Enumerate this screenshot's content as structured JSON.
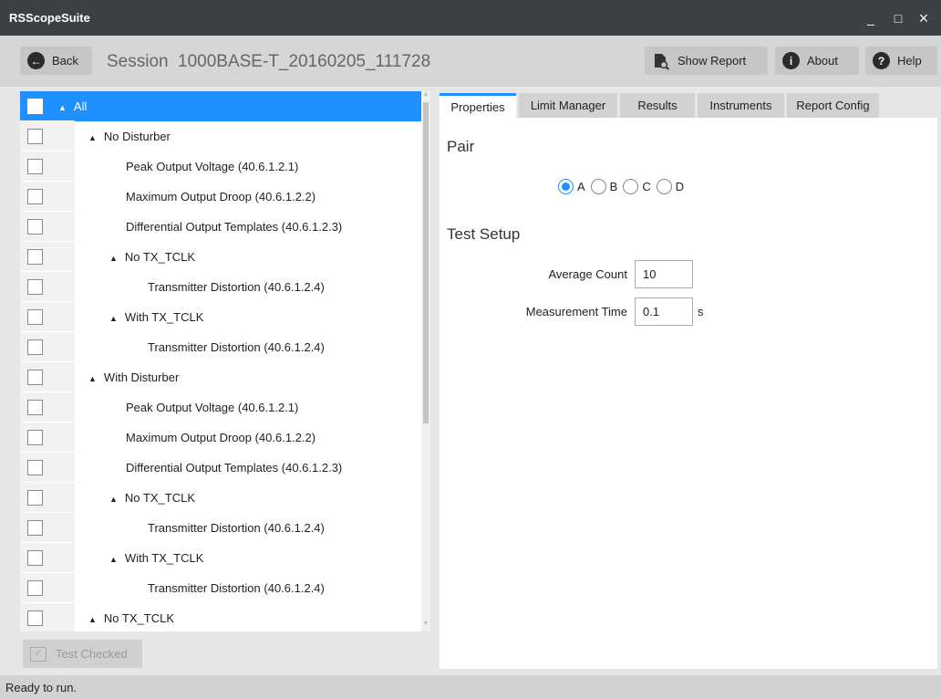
{
  "window": {
    "title": "RSScopeSuite",
    "minimize": "_",
    "maximize": "□",
    "close": "×"
  },
  "toolbar": {
    "back_label": "Back",
    "session_label": "Session",
    "session_name": "1000BASE-T_20160205_111728",
    "show_report_label": "Show Report",
    "about_label": "About",
    "help_label": "Help"
  },
  "tree": {
    "rows": [
      {
        "label": "All",
        "indent": 0,
        "expander": true,
        "selected": true
      },
      {
        "label": "No Disturber",
        "indent": 1,
        "expander": true
      },
      {
        "label": "Peak Output Voltage (40.6.1.2.1)",
        "indent": 2,
        "expander": false
      },
      {
        "label": "Maximum Output Droop (40.6.1.2.2)",
        "indent": 2,
        "expander": false
      },
      {
        "label": "Differential Output Templates (40.6.1.2.3)",
        "indent": 2,
        "expander": false
      },
      {
        "label": "No TX_TCLK",
        "indent": 2,
        "expander": true
      },
      {
        "label": "Transmitter Distortion (40.6.1.2.4)",
        "indent": 3,
        "expander": false
      },
      {
        "label": "With TX_TCLK",
        "indent": 2,
        "expander": true
      },
      {
        "label": "Transmitter Distortion (40.6.1.2.4)",
        "indent": 3,
        "expander": false
      },
      {
        "label": "With Disturber",
        "indent": 1,
        "expander": true
      },
      {
        "label": "Peak Output Voltage (40.6.1.2.1)",
        "indent": 2,
        "expander": false
      },
      {
        "label": "Maximum Output Droop (40.6.1.2.2)",
        "indent": 2,
        "expander": false
      },
      {
        "label": "Differential Output Templates (40.6.1.2.3)",
        "indent": 2,
        "expander": false
      },
      {
        "label": "No TX_TCLK",
        "indent": 2,
        "expander": true
      },
      {
        "label": "Transmitter Distortion (40.6.1.2.4)",
        "indent": 3,
        "expander": false
      },
      {
        "label": "With TX_TCLK",
        "indent": 2,
        "expander": true
      },
      {
        "label": "Transmitter Distortion (40.6.1.2.4)",
        "indent": 3,
        "expander": false
      },
      {
        "label": "No TX_TCLK",
        "indent": 1,
        "expander": true
      }
    ]
  },
  "test_checked_label": "Test Checked",
  "tabs": [
    "Properties",
    "Limit Manager",
    "Results",
    "Instruments",
    "Report Config"
  ],
  "properties": {
    "pair_title": "Pair",
    "pair_options": [
      "A",
      "B",
      "C",
      "D"
    ],
    "pair_selected": "A",
    "test_setup_title": "Test Setup",
    "average_count_label": "Average Count",
    "average_count_value": "10",
    "measurement_time_label": "Measurement Time",
    "measurement_time_value": "0.1",
    "measurement_time_unit": "s"
  },
  "status": "Ready to run.",
  "colors": {
    "accent": "#1e90ff",
    "titlebar": "#3c4043"
  }
}
